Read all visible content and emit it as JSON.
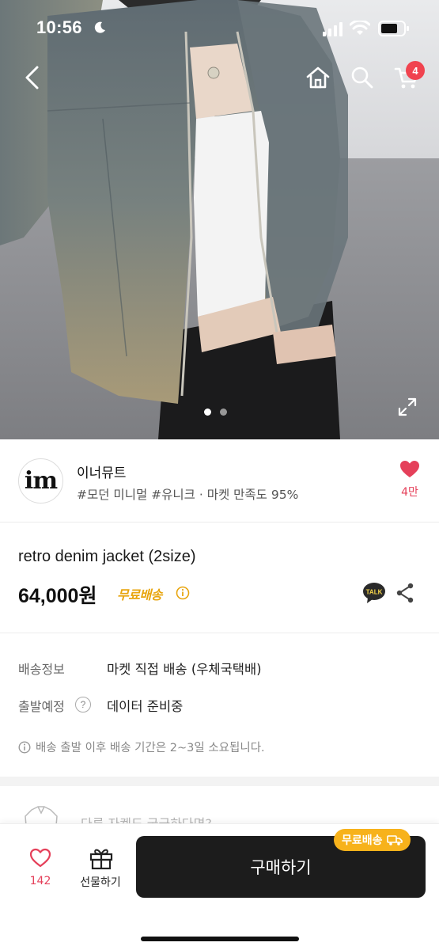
{
  "status_bar": {
    "time": "10:56"
  },
  "nav": {
    "cart_count": "4"
  },
  "gallery": {
    "total": 2,
    "active_index": 0
  },
  "shop": {
    "logo_text": "im",
    "name": "이너뮤트",
    "tags": "#모던 미니멀 #유니크 · 마켓 만족도 95%",
    "likes": "4만"
  },
  "product": {
    "title": "retro denim jacket (2size)",
    "price": "64,000원",
    "shipping_badge": "무료배송",
    "talk_label": "TALK"
  },
  "delivery": {
    "rows": [
      {
        "label": "배송정보",
        "value": "마켓 직접 배송 (우체국택배)"
      },
      {
        "label": "출발예정",
        "value": "데이터 준비중"
      }
    ],
    "notice": "배송 출발 이후 배송 기간은 2~3일 소요됩니다."
  },
  "peek": {
    "text": "다른 자켓도 궁금하다면?"
  },
  "bottom_bar": {
    "like_count": "142",
    "gift_label": "선물하기",
    "buy_label": "구매하기",
    "buy_badge": "무료배송"
  },
  "colors": {
    "accent_red": "#e5405a",
    "badge_red": "#f0434f",
    "ship_yellow": "#e8a50e",
    "buy_dark": "#1c1c1c"
  }
}
